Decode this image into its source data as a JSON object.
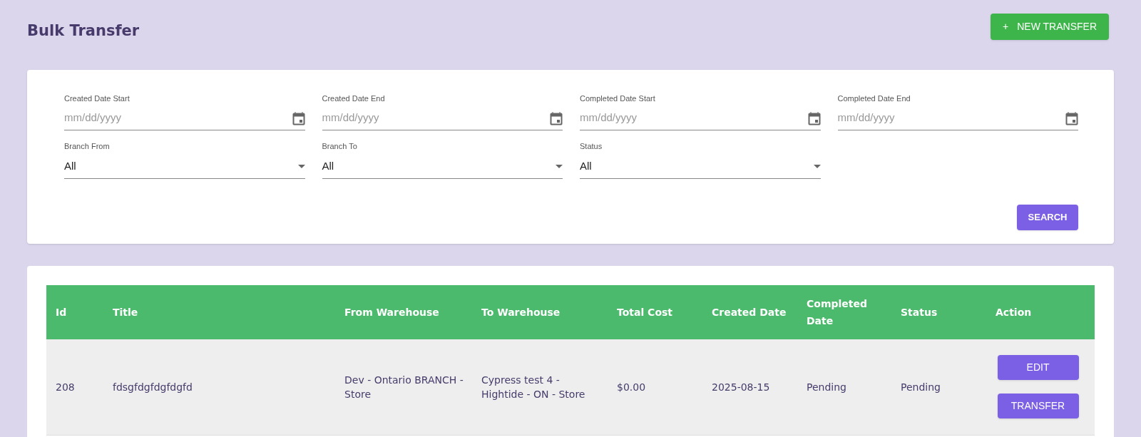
{
  "page": {
    "title": "Bulk Transfer",
    "new_button": {
      "icon": "+",
      "label": "NEW TRANSFER"
    }
  },
  "filters": [
    {
      "kind": "date",
      "label": "Created Date Start",
      "placeholder": "mm/dd/yyyy"
    },
    {
      "kind": "date",
      "label": "Created Date End",
      "placeholder": "mm/dd/yyyy"
    },
    {
      "kind": "date",
      "label": "Completed Date Start",
      "placeholder": "mm/dd/yyyy"
    },
    {
      "kind": "date",
      "label": "Completed Date End",
      "placeholder": "mm/dd/yyyy"
    },
    {
      "kind": "select",
      "label": "Branch From",
      "value": "All"
    },
    {
      "kind": "select",
      "label": "Branch To",
      "value": "All"
    },
    {
      "kind": "select",
      "label": "Status",
      "value": "All"
    }
  ],
  "search_button": "SEARCH",
  "table": {
    "columns": [
      "Id",
      "Title",
      "From Warehouse",
      "To Warehouse",
      "Total Cost",
      "Created Date",
      "Completed Date",
      "Status",
      "Action"
    ],
    "rows": [
      {
        "cells": [
          "208",
          "fdsgfdgfdgfdgfd",
          "Dev - Ontario BRANCH - Store",
          "Cypress test 4 - Hightide - ON - Store",
          "$0.00",
          "2025-08-15",
          "Pending",
          "Pending"
        ],
        "actions": [
          "EDIT",
          "TRANSFER"
        ]
      }
    ]
  }
}
